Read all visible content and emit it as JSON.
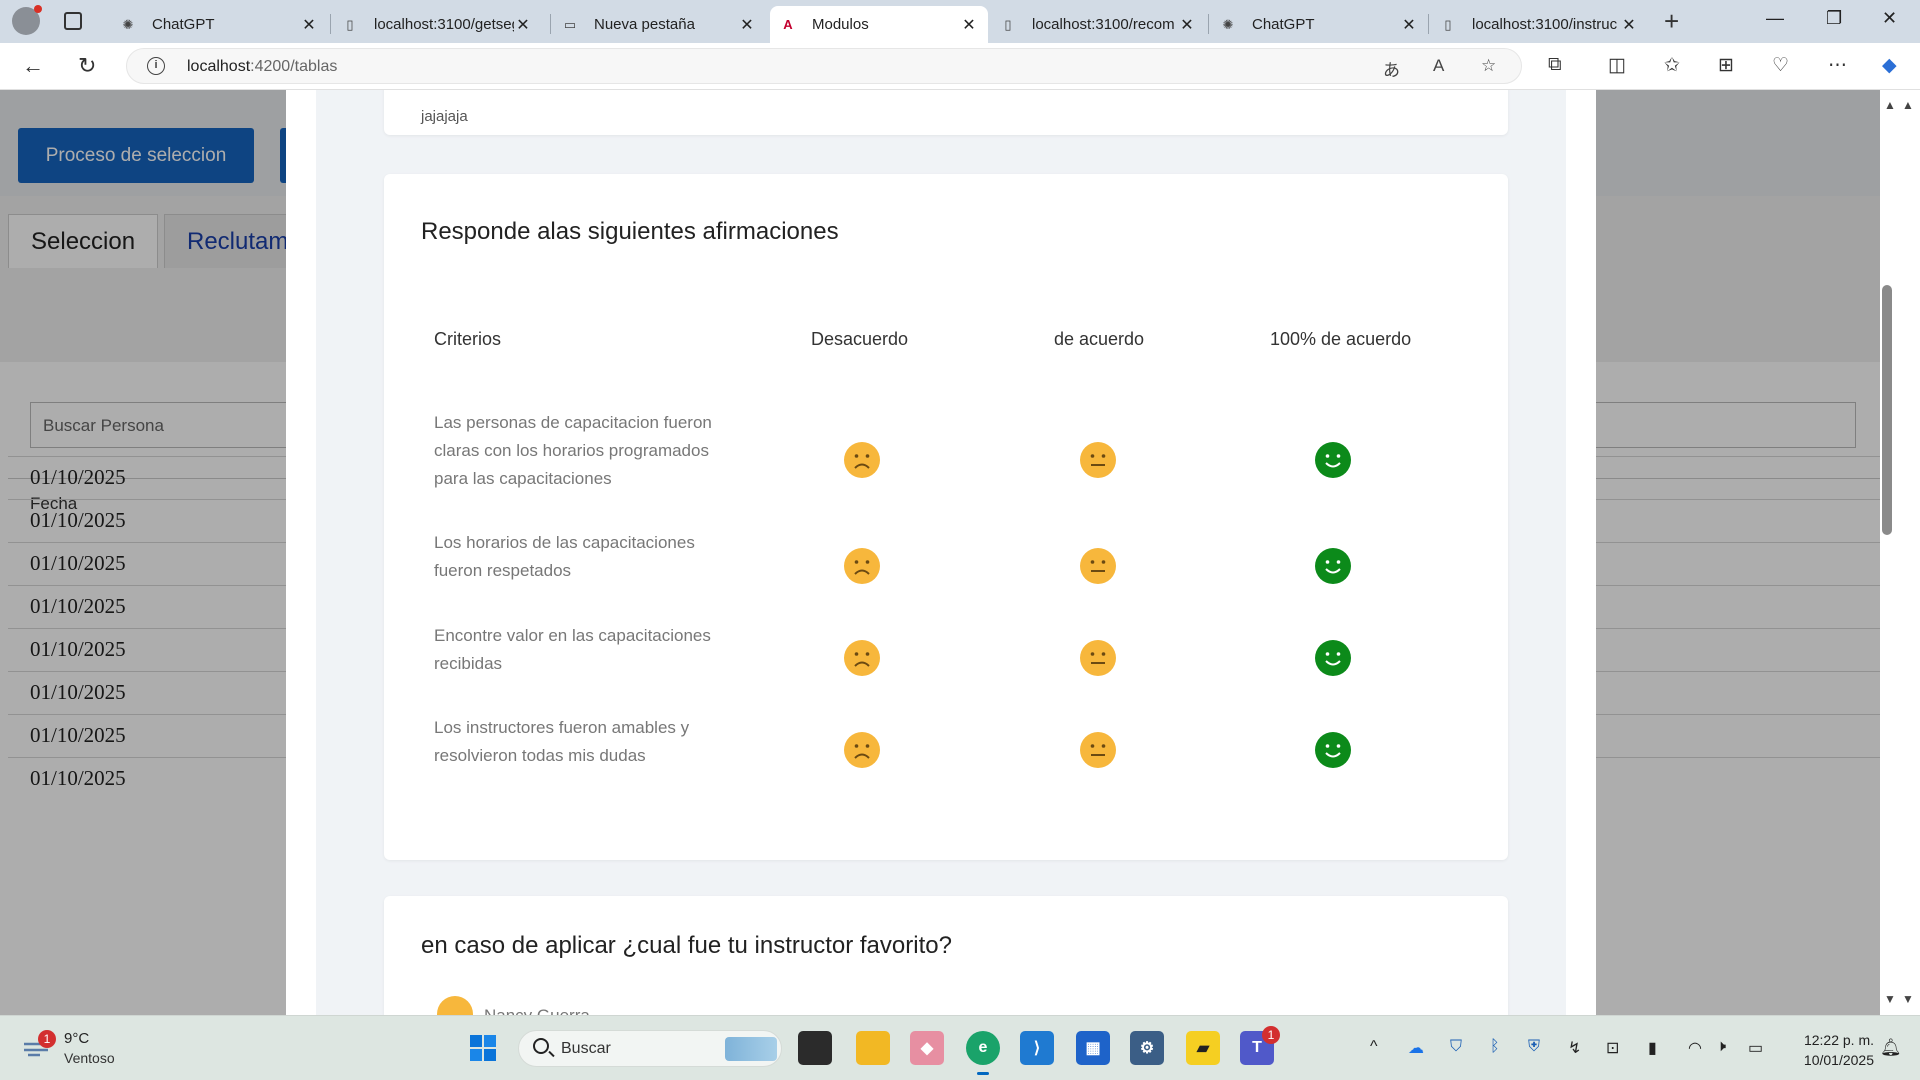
{
  "browser": {
    "tabs": [
      {
        "title": "ChatGPT",
        "icon": "chatgpt-icon",
        "active": false
      },
      {
        "title": "localhost:3100/getseg",
        "icon": "page-icon",
        "active": false
      },
      {
        "title": "Nueva pestaña",
        "icon": "newtab-icon",
        "active": false
      },
      {
        "title": "Modulos",
        "icon": "angular-icon",
        "active": true
      },
      {
        "title": "localhost:3100/recom",
        "icon": "page-icon",
        "active": false
      },
      {
        "title": "ChatGPT",
        "icon": "chatgpt-icon",
        "active": false
      },
      {
        "title": "localhost:3100/instruc",
        "icon": "page-icon",
        "active": false
      }
    ],
    "url_host": "localhost",
    "url_path": ":4200/tablas"
  },
  "background": {
    "primary_button": "Proceso de seleccion",
    "tabs": [
      "Seleccion",
      "Reclutam"
    ],
    "search_placeholder": "Buscar Persona",
    "table_header": "Fecha",
    "rows": [
      "01/10/2025",
      "01/10/2025",
      "01/10/2025",
      "01/10/2025",
      "01/10/2025",
      "01/10/2025",
      "01/10/2025",
      "01/10/2025"
    ]
  },
  "modal": {
    "prev_card_text": "jajajaja",
    "survey": {
      "title": "Responde alas siguientes afirmaciones",
      "columns": [
        "Criterios",
        "Desacuerdo",
        "de acuerdo",
        "100% de acuerdo"
      ],
      "criteria": [
        "Las personas de capacitacion fueron claras con los horarios programados para las capacitaciones",
        "Los horarios de las capacitaciones fueron respetados",
        "Encontre valor en las capacitaciones recibidas",
        "Los instructores fueron amables y resolvieron todas mis dudas"
      ],
      "face_colors": {
        "sad": "#f7b73c",
        "neutral": "#f7b73c",
        "happy": "#0c8a1a"
      }
    },
    "favorite": {
      "title": "en caso de aplicar ¿cual fue tu instructor favorito?",
      "first_option": "Nancy Guerra"
    }
  },
  "taskbar": {
    "weather_badge": "1",
    "weather_temp": "9°C",
    "weather_desc": "Ventoso",
    "search_label": "Buscar",
    "teams_badge": "1",
    "time": "12:22 p. m.",
    "date": "10/01/2025"
  }
}
